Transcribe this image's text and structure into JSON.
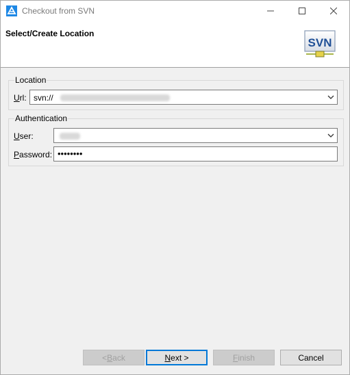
{
  "window": {
    "title": "Checkout from SVN",
    "icon": "eclipse-icon",
    "controls": [
      "minimize-icon",
      "maximize-icon",
      "close-icon"
    ]
  },
  "header": {
    "title": "Select/Create Location",
    "logo_text": "SVN"
  },
  "location": {
    "group_title": "Location",
    "url_label_accel": "U",
    "url_label_rest": "rl:",
    "url_value": "svn://"
  },
  "authentication": {
    "group_title": "Authentication",
    "user_label_accel": "U",
    "user_label_rest": "ser:",
    "password_label_accel": "P",
    "password_label_rest": "assword:",
    "password_value": "••••••••"
  },
  "buttons": {
    "back_prefix": "< ",
    "back_accel": "B",
    "back_rest": "ack",
    "next_accel": "N",
    "next_rest": "ext >",
    "finish_accel": "F",
    "finish_rest": "inish",
    "cancel": "Cancel"
  },
  "colors": {
    "accent": "#0078d7",
    "window_bg": "#f0f0f0"
  }
}
